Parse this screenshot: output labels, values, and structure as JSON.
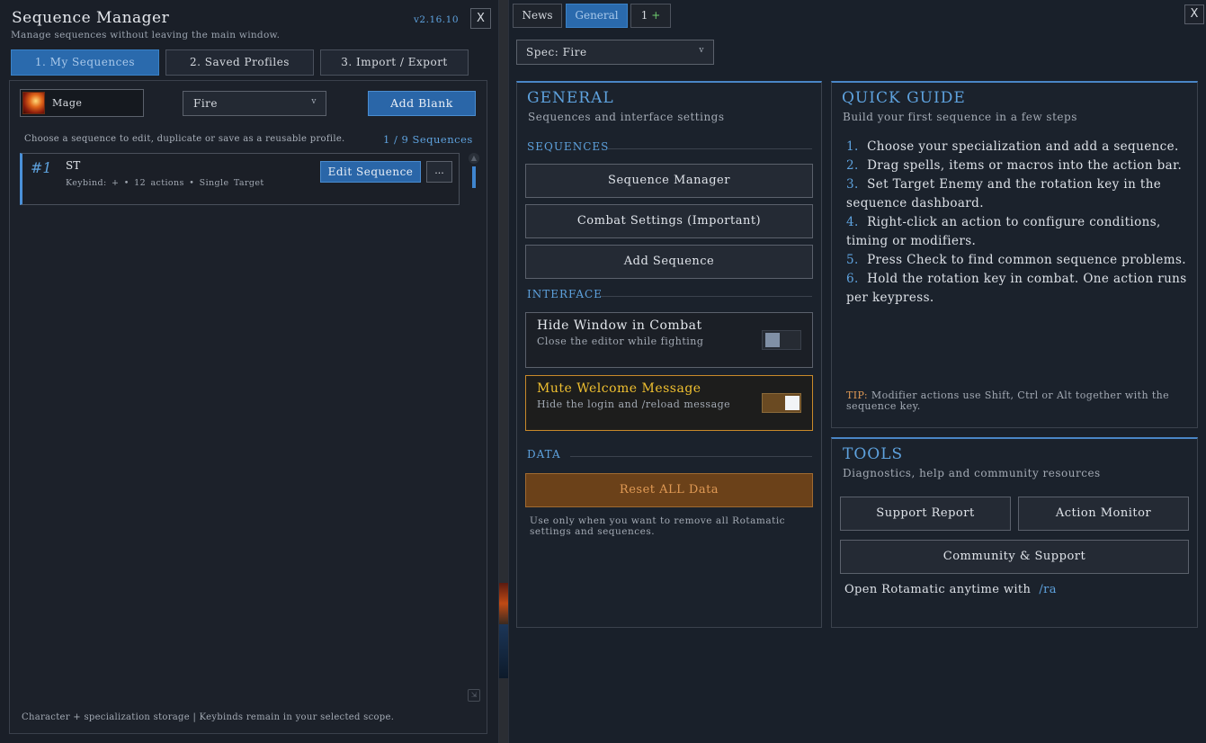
{
  "left": {
    "title": "Sequence Manager",
    "subtitle": "Manage sequences without leaving the main window.",
    "version": "v2.16.10",
    "close_label": "X",
    "tabs": [
      {
        "label": "1. My Sequences",
        "active": true
      },
      {
        "label": "2. Saved Profiles",
        "active": false
      },
      {
        "label": "3. Import / Export",
        "active": false
      }
    ],
    "class_label": "Mage",
    "class_icon": "fire-mage-icon",
    "spec_select": {
      "value": "Fire",
      "chevron": "v"
    },
    "add_blank_label": "Add Blank",
    "hint": "Choose a sequence to edit, duplicate or save as a reusable profile.",
    "count": "1 / 9 Sequences",
    "sequences": [
      {
        "number": "#1",
        "name": "ST",
        "meta": "Keybind: +  •  12 actions  •  Single Target",
        "edit_label": "Edit Sequence",
        "more_label": "..."
      }
    ],
    "footer": "Character + specialization storage  |  Keybinds remain in your selected scope."
  },
  "right": {
    "tabs": [
      {
        "label": "News",
        "active": false
      },
      {
        "label": "General",
        "active": true
      },
      {
        "label": "1",
        "plus": "+",
        "active": false
      }
    ],
    "close_label": "X",
    "spec_select": {
      "value": "Spec: Fire",
      "chevron": "v"
    },
    "general": {
      "title": "GENERAL",
      "subtitle": "Sequences and interface settings",
      "sequences_head": "SEQUENCES",
      "buttons": [
        "Sequence Manager",
        "Combat Settings (Important)",
        "Add Sequence"
      ],
      "interface_head": "INTERFACE",
      "toggles": [
        {
          "title": "Hide Window in Combat",
          "subtitle": "Close the editor while fighting",
          "on": false
        },
        {
          "title": "Mute Welcome Message",
          "subtitle": "Hide the login and /reload message",
          "on": true
        }
      ],
      "data_head": "DATA",
      "reset_label": "Reset ALL Data",
      "reset_note": "Use only when you want to remove all Rotamatic settings and sequences."
    },
    "guide": {
      "title": "QUICK GUIDE",
      "subtitle": "Build your first sequence in a few steps",
      "steps": [
        {
          "n": "1.",
          "text": "Choose your specialization and add a sequence."
        },
        {
          "n": "2.",
          "text": "Drag spells, items or macros into the action bar."
        },
        {
          "n": "3.",
          "text": "Set Target Enemy and the rotation key in the sequence dashboard."
        },
        {
          "n": "4.",
          "text": "Right-click an action to configure conditions, timing or modifiers."
        },
        {
          "n": "5.",
          "text": "Press Check to find common sequence problems."
        },
        {
          "n": "6.",
          "text": "Hold the rotation key in combat. One action runs per keypress."
        }
      ],
      "tip_label": "TIP:",
      "tip_text": "Modifier actions use Shift, Ctrl or Alt together with the sequence key."
    },
    "tools": {
      "title": "TOOLS",
      "subtitle": "Diagnostics, help and community resources",
      "support_report": "Support Report",
      "action_monitor": "Action Monitor",
      "community": "Community & Support",
      "open_text": "Open Rotamatic anytime with",
      "slash_cmd": "/ra"
    }
  },
  "colors": {
    "accent": "#5ea2de",
    "active_tab": "#2a6aad",
    "warning": "#f0c030",
    "danger_bg": "#6b4119",
    "danger_text": "#e09a55"
  }
}
